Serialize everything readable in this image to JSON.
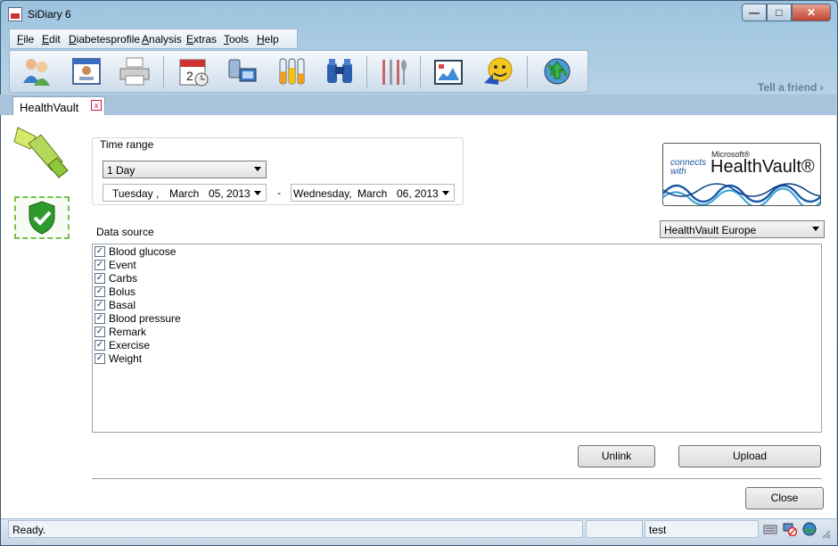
{
  "window": {
    "title": "SiDiary 6",
    "minimize": "—",
    "maximize": "□",
    "close": "✕"
  },
  "menu": [
    "File",
    "Edit",
    "Diabetesprofile",
    "Analysis",
    "Extras",
    "Tools",
    "Help"
  ],
  "toolbar": {
    "icons": [
      "people-icon",
      "id-card-icon",
      "printer-icon",
      "calendar-icon",
      "devices-icon",
      "test-tubes-icon",
      "binoculars-icon",
      "cutlery-icon",
      "chart-picture-icon",
      "smiley-icon",
      "globe-upload-icon"
    ],
    "tell_a_friend": "Tell a friend ›"
  },
  "tab": {
    "label": "HealthVault",
    "close": "x"
  },
  "time_range": {
    "legend": "Time range",
    "period": "1 Day",
    "from": {
      "weekday": "Tuesday",
      "sep": ",",
      "month": "March",
      "day_year": "05, 2013"
    },
    "dash": "-",
    "to": {
      "weekday": "Wednesday,",
      "month": "March",
      "day_year": "06, 2013"
    }
  },
  "logo": {
    "connects": "connects",
    "with": "with",
    "microsoft": "Microsoft®",
    "name": "HealthVault®"
  },
  "data_source": {
    "label": "Data source",
    "server": "HealthVault Europe",
    "items": [
      {
        "label": "Blood glucose",
        "checked": true
      },
      {
        "label": "Event",
        "checked": true
      },
      {
        "label": "Carbs",
        "checked": true
      },
      {
        "label": "Bolus",
        "checked": true
      },
      {
        "label": "Basal",
        "checked": true
      },
      {
        "label": "Blood pressure",
        "checked": true
      },
      {
        "label": "Remark",
        "checked": true
      },
      {
        "label": "Exercise",
        "checked": true
      },
      {
        "label": "Weight",
        "checked": true
      }
    ]
  },
  "buttons": {
    "unlink": "Unlink",
    "upload": "Upload",
    "close": "Close"
  },
  "status": {
    "ready": "Ready.",
    "user": "test"
  },
  "colors": {
    "accent": "#1a5ca8",
    "check_green": "#2e9a2e"
  }
}
